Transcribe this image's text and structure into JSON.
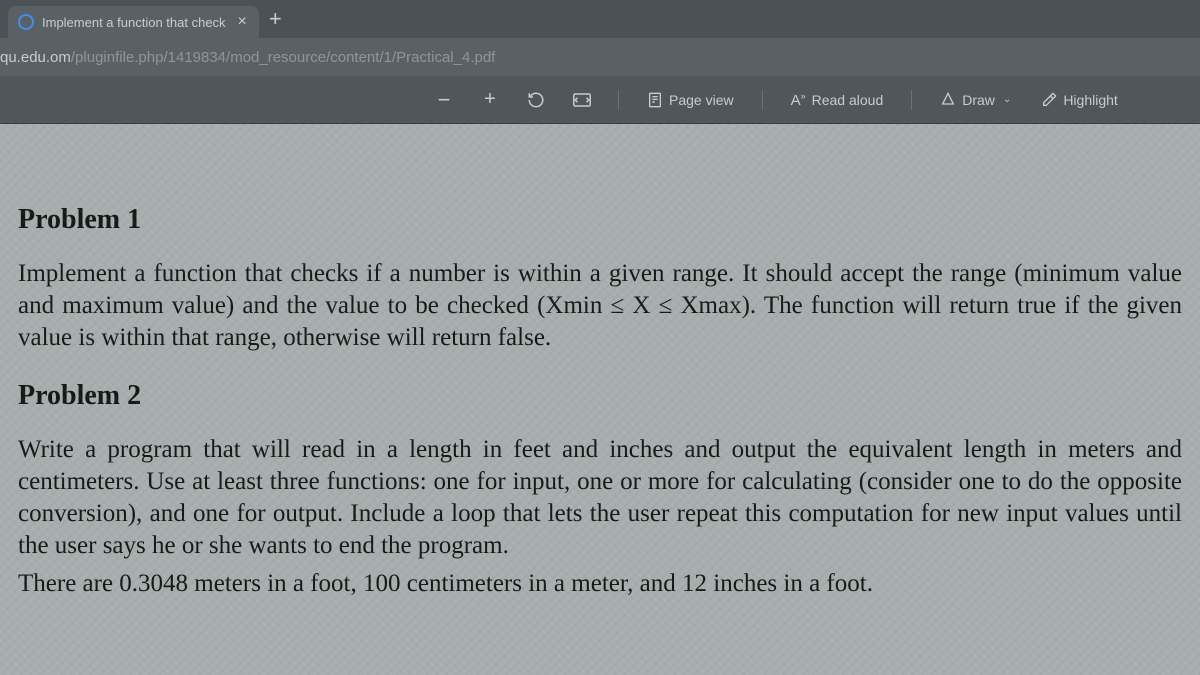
{
  "tab": {
    "title": "Implement a function that check",
    "close": "×",
    "new": "+"
  },
  "url": {
    "domain": "qu.edu.om",
    "path": "/pluginfile.php/1419834/mod_resource/content/1/Practical_4.pdf"
  },
  "toolbar": {
    "zoom_out": "−",
    "zoom_in": "+",
    "rotate": "↻",
    "fit": "⛶",
    "page_view": "Page view",
    "read_aloud": "Read aloud",
    "draw": "Draw",
    "highlight": "Highlight"
  },
  "document": {
    "p1_heading": "Problem 1",
    "p1_body": "Implement a function that checks if a number is within a given range. It should accept the range (minimum value and maximum value) and the value to be checked (Xmin ≤ X ≤ Xmax). The function will return true if the given value is within that range, otherwise will return false.",
    "p2_heading": "Problem 2",
    "p2_body": "Write a program that will read in a length in feet and inches and output the equivalent length in meters and centimeters. Use at least three functions: one for input, one or more for calculating (consider one to do the opposite conversion), and one for output. Include a loop that lets the user repeat this computation for new input values until the user says he or she wants to end the program.",
    "p2_cutoff": "There are 0.3048 meters in a foot, 100 centimeters in a meter, and 12 inches in a foot."
  }
}
